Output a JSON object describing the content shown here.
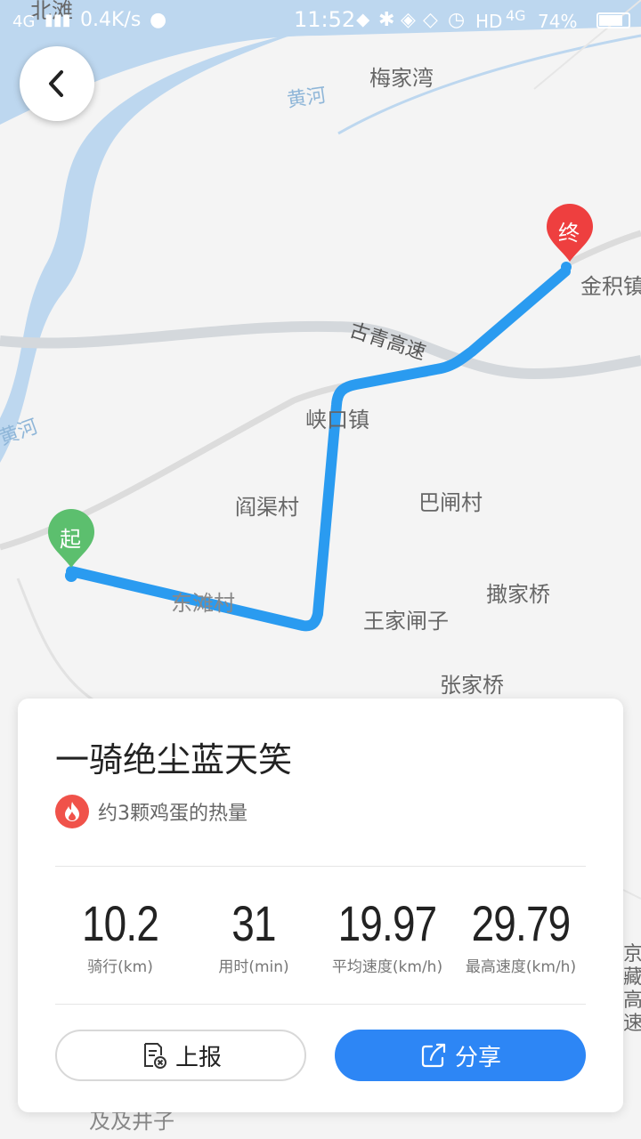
{
  "status_bar": {
    "network": "4G",
    "speed": "0.4K/s",
    "time": "11:52",
    "hd": "HD",
    "network2": "4G",
    "battery": "74%"
  },
  "map": {
    "labels": {
      "beitan": "北滩",
      "meijiawan": "梅家湾",
      "huanghe_top": "黄河",
      "huanghe_left": "黄河",
      "jinjizhen": "金积镇",
      "highway": "古青高速",
      "xiakouzhen": "峡口镇",
      "yanqucun": "阎渠村",
      "bawencun": "巴闸村",
      "sajiaqiao": "撖家桥",
      "wangjiazhazi": "王家闸子",
      "dongtancun": "东滩村",
      "zhangjiaqiao": "张家桥",
      "bottom_hidden": "及及井子",
      "highway_right": "京藏高速"
    },
    "start_marker": "起",
    "end_marker": "终"
  },
  "card": {
    "title": "一骑绝尘蓝天笑",
    "calories_text": "约3颗鸡蛋的热量",
    "stats": [
      {
        "value": "10.2",
        "label": "骑行(km)"
      },
      {
        "value": "31",
        "label": "用时(min)"
      },
      {
        "value": "19.97",
        "label": "平均速度(km/h)"
      },
      {
        "value": "29.79",
        "label": "最高速度(km/h)"
      }
    ],
    "report_label": "上报",
    "share_label": "分享"
  },
  "colors": {
    "route": "#2a9bf0",
    "start_marker": "#5cbf6e",
    "end_marker": "#ee3f3f",
    "share_button": "#2d86f5",
    "calorie_icon": "#f0524a"
  }
}
